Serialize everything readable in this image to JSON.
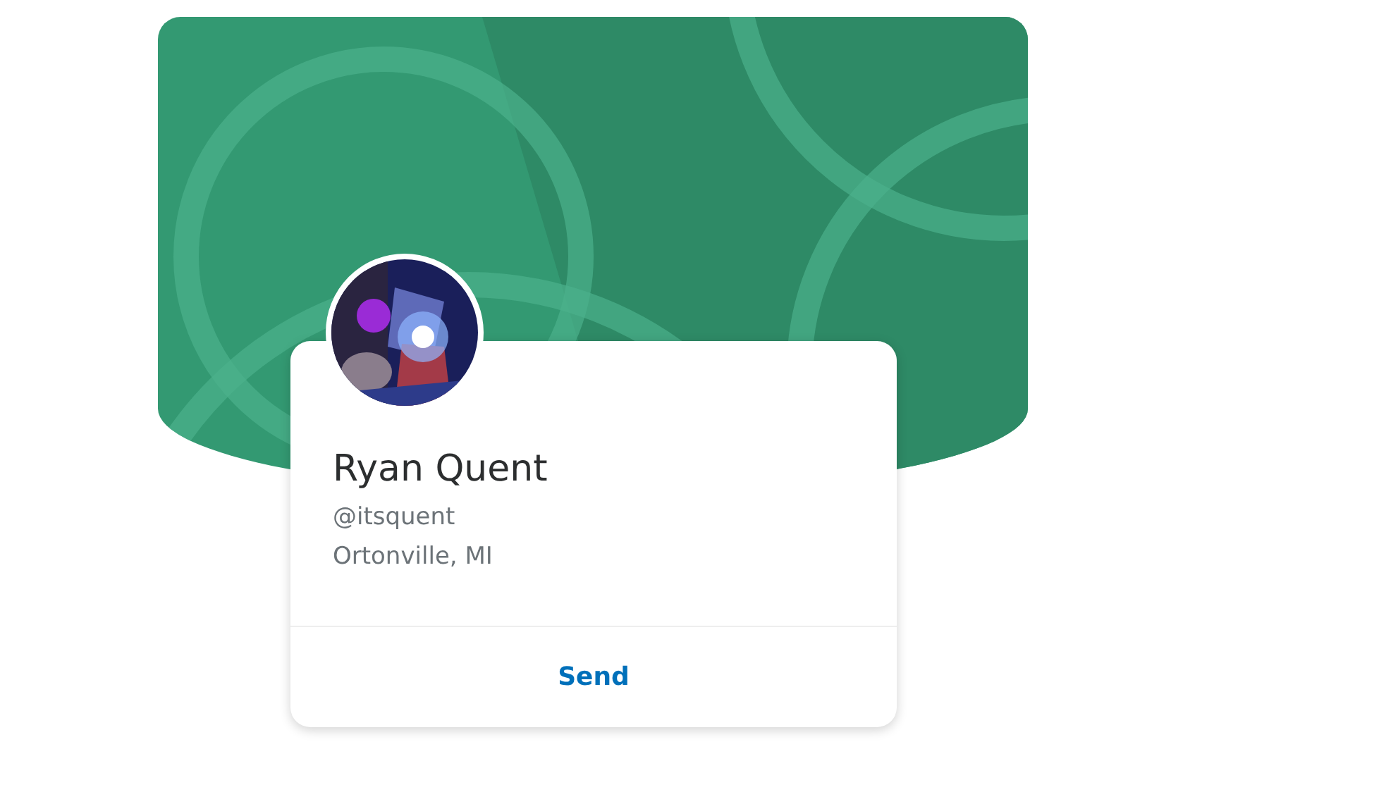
{
  "profile": {
    "name": "Ryan Quent",
    "handle": "@itsquent",
    "location": "Ortonville, MI"
  },
  "actions": [
    {
      "label": "Send"
    }
  ]
}
